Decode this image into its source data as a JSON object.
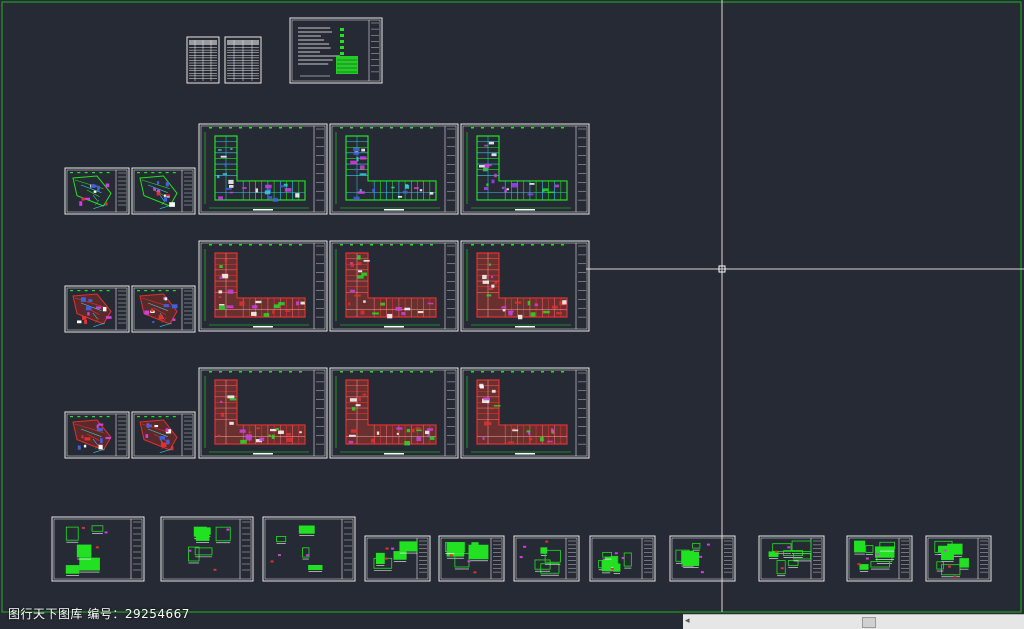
{
  "watermark": "图行天下图库 编号：29254667",
  "scrollbar": {
    "left_arrow": "◂"
  },
  "colors": {
    "background": "#252a34",
    "sheet_border": "#e8e8e8",
    "drawing_primary": "#22e022",
    "viewport_frame": "#20a020",
    "crosshair": "#d8d8d8",
    "red_walls": "#e03030",
    "magenta": "#d040e0",
    "cyan": "#30d0e0",
    "blue": "#4060e0"
  }
}
